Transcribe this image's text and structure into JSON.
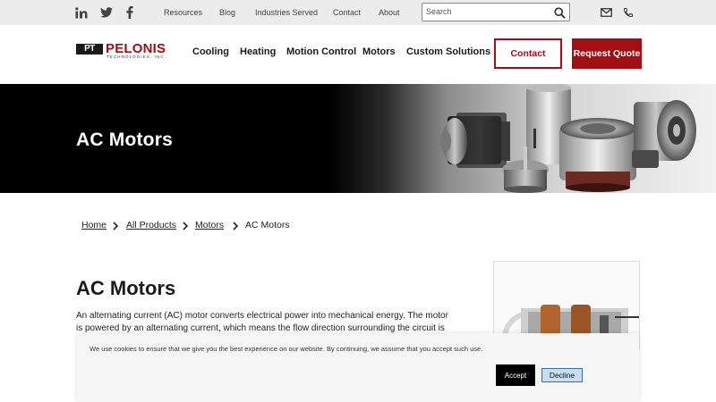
{
  "topbar": {
    "social": [
      {
        "name": "linkedin-icon",
        "glyph": "in"
      },
      {
        "name": "twitter-icon"
      },
      {
        "name": "facebook-icon"
      }
    ],
    "links": [
      "Resources",
      "Blog",
      "Industries Served",
      "Contact",
      "About"
    ],
    "search": {
      "placeholder": "Search",
      "value": ""
    },
    "icons": [
      "mail-icon",
      "phone-icon"
    ]
  },
  "brand": {
    "logo_mark": "PT",
    "logo_name": "PELONIS",
    "logo_sub": "TECHNOLOGIES, INC.",
    "accent_color": "#a30d14"
  },
  "nav": {
    "items": [
      "Cooling",
      "Heating",
      "Motion Control",
      "Motors",
      "Custom Solutions"
    ],
    "contact_label": "Contact",
    "quote_label": "Request Quote"
  },
  "hero": {
    "title": "AC Motors"
  },
  "breadcrumb": {
    "items": [
      "Home",
      "All Products",
      "Motors",
      "AC Motors"
    ]
  },
  "content": {
    "title": "AC Motors",
    "body": "An alternating current (AC) motor converts electrical power into mechanical energy. The motor is powered by an alternating current, which means the flow direction surrounding the circuit is"
  },
  "cookie": {
    "text": "We use cookies to ensure that we give you the best experience on our website. By continuing, we assume that you accept such use.",
    "accept_label": "Accept",
    "decline_label": "Decline"
  }
}
